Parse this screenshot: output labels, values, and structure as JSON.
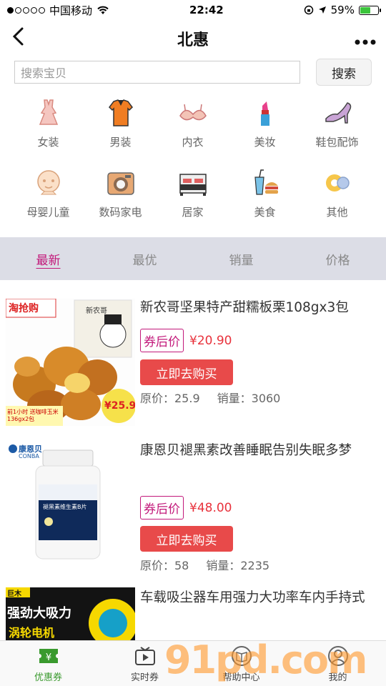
{
  "status": {
    "carrier": "中国移动",
    "time": "22:42",
    "battery": "59%",
    "battery_level": 0.59
  },
  "nav": {
    "title": "北惠",
    "back_icon": "chevron-left-icon",
    "more_icon": "more-icon"
  },
  "search": {
    "placeholder": "搜索宝贝",
    "button": "搜索"
  },
  "categories": [
    {
      "label": "女装",
      "icon": "dress-icon"
    },
    {
      "label": "男装",
      "icon": "shirt-icon"
    },
    {
      "label": "内衣",
      "icon": "bra-icon"
    },
    {
      "label": "美妆",
      "icon": "lipstick-icon"
    },
    {
      "label": "鞋包配饰",
      "icon": "high-heel-icon"
    },
    {
      "label": "母婴儿童",
      "icon": "baby-icon"
    },
    {
      "label": "数码家电",
      "icon": "camera-icon"
    },
    {
      "label": "居家",
      "icon": "bed-icon"
    },
    {
      "label": "美食",
      "icon": "food-icon"
    },
    {
      "label": "其他",
      "icon": "other-icon"
    }
  ],
  "tabs": [
    {
      "label": "最新",
      "active": true
    },
    {
      "label": "最优",
      "active": false
    },
    {
      "label": "销量",
      "active": false
    },
    {
      "label": "价格",
      "active": false
    }
  ],
  "products": [
    {
      "title": "新农哥坚果特产甜糯板栗108gx3包",
      "coupon_label": "券后价",
      "price": "¥20.90",
      "buy_label": "立即去购买",
      "original_price": "原价：25.9",
      "sales": "销量：3060",
      "img": {
        "badge": "淘抢购",
        "brand": "新农哥",
        "promo_price": "¥25.9",
        "promo_note": "前1小时 送咖啡玉米136gx2包"
      }
    },
    {
      "title": "康恩贝褪黑素改善睡眠告别失眠多梦",
      "coupon_label": "券后价",
      "price": "¥48.00",
      "buy_label": "立即去购买",
      "original_price": "原价：58",
      "sales": "销量：2235",
      "img": {
        "brand": "康恩贝",
        "brand_en": "CONBA",
        "label": "褪黑素维生素B片"
      }
    },
    {
      "title": "车载吸尘器车用强力大功率车内手持式",
      "img": {
        "brand": "巨木",
        "slogan": "强劲大吸力",
        "sub": "涡轮电机"
      }
    }
  ],
  "bottom_nav": [
    {
      "label": "优惠券",
      "icon": "coupon-icon",
      "active": true
    },
    {
      "label": "实时券",
      "icon": "video-icon",
      "active": false
    },
    {
      "label": "帮助中心",
      "icon": "book-icon",
      "active": false
    },
    {
      "label": "我的",
      "icon": "user-icon",
      "active": false
    }
  ],
  "watermark": "91pd.com"
}
